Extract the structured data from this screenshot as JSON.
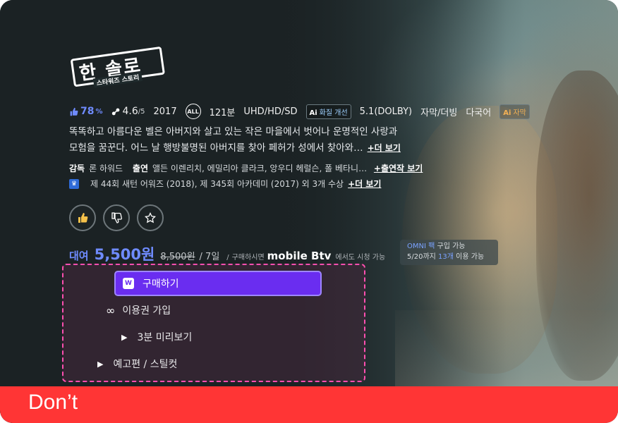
{
  "title": {
    "main": "한 솔로",
    "sub": "스타워즈 스토리"
  },
  "meta": {
    "like_pct": "78",
    "like_unit": "%",
    "rating": "4.6",
    "rating_max": "/5",
    "year": "2017",
    "age_badge": "ALL",
    "runtime": "121분",
    "quality": "UHD/HD/SD",
    "ai_quality": "화질 개선",
    "audio": "5.1(DOLBY)",
    "subs": "자막/더빙",
    "languages": "다국어",
    "ai_subtitle": "자막",
    "ai_mark": "Ai"
  },
  "description": {
    "line1": "똑똑하고 아름다운 벨은 아버지와 살고 있는 작은 마을에서 벗어나 운명적인 사랑과",
    "line2": "모험을 꿈꾼다. 어느 날 행방불명된 아버지를 찾아 페허가 성에서 찾아와…",
    "more": "+더 보기"
  },
  "credits": {
    "director_label": "감독",
    "director": "론 하워드",
    "cast_label": "출연",
    "cast": "앨든 이렌리치, 에밀리아 클라크, 앙우디 헤럴슨, 폴 베타니…",
    "cast_more": "+출연작 보기"
  },
  "awards": {
    "text": "제 44회 새턴 어워즈 (2018), 제 345회 아카데미 (2017) 외 3개 수상",
    "more": "+더 보기"
  },
  "price": {
    "label": "대여",
    "value": "5,500원",
    "original": "8,500원",
    "period": "/ 7일",
    "sep": "/",
    "note": "구매하시면",
    "brand": "mobile Btv",
    "note2": "에서도 시청 가능"
  },
  "omni": {
    "name": "OMNI 팩",
    "line1_rest": " 구입 가능",
    "line2_a": "5/20까지 ",
    "line2_count": "13개",
    "line2_b": " 이용 가능"
  },
  "menu": {
    "buy": "구매하기",
    "subscribe": "이용권 가입",
    "preview": "3분 미리보기",
    "trailer": "예고편 / 스틸컷"
  },
  "banner": "Don’t",
  "colors": {
    "accent": "#6f8bff",
    "buy": "#6a2df0",
    "dashed": "#ff4fb0",
    "banner": "#ff3535"
  }
}
